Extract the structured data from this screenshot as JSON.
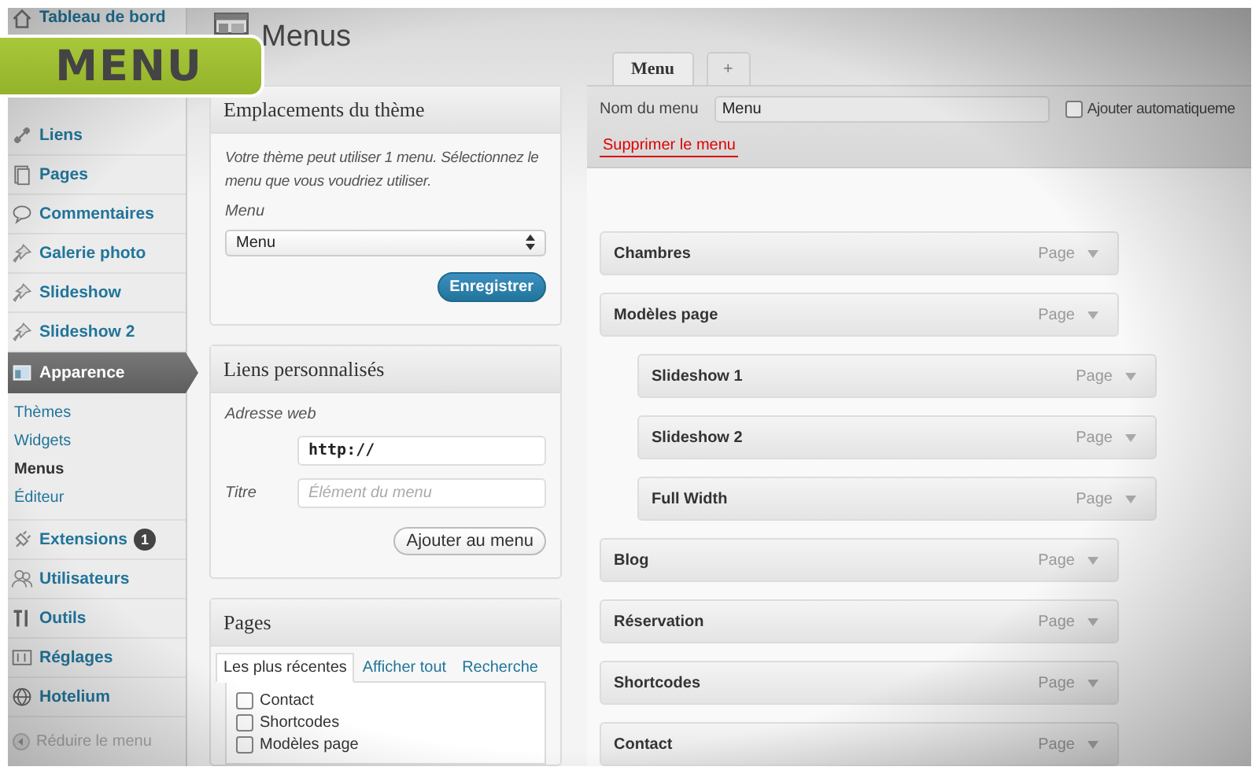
{
  "banner": {
    "label": "MENU"
  },
  "sidebar": {
    "items": [
      {
        "label": "Tableau de bord",
        "selected": false
      },
      {
        "label": "Liens",
        "selected": false
      },
      {
        "label": "Pages",
        "selected": false
      },
      {
        "label": "Commentaires",
        "selected": false
      },
      {
        "label": "Galerie photo",
        "selected": false
      },
      {
        "label": "Slideshow",
        "selected": false
      },
      {
        "label": "Slideshow 2",
        "selected": false
      },
      {
        "label": "Apparence",
        "selected": true,
        "children": [
          {
            "label": "Thèmes",
            "selected": false
          },
          {
            "label": "Widgets",
            "selected": false
          },
          {
            "label": "Menus",
            "selected": true
          },
          {
            "label": "Éditeur",
            "selected": false
          }
        ]
      },
      {
        "label": "Extensions",
        "selected": false,
        "badge": "1"
      },
      {
        "label": "Utilisateurs",
        "selected": false
      },
      {
        "label": "Outils",
        "selected": false
      },
      {
        "label": "Réglages",
        "selected": false
      },
      {
        "label": "Hotelium",
        "selected": false
      }
    ],
    "collapse": "Réduire le menu"
  },
  "page_title": "Menus",
  "theme_locations": {
    "title": "Emplacements du thème",
    "description": "Votre thème peut utiliser 1 menu. Sélectionnez le menu que vous voudriez utiliser.",
    "menu_label": "Menu",
    "menu_value": "Menu",
    "save_button": "Enregistrer"
  },
  "custom_links": {
    "title": "Liens personnalisés",
    "url_label": "Adresse web",
    "url_value": "http://",
    "title_label": "Titre",
    "title_placeholder": "Élément du menu",
    "add_button": "Ajouter au menu"
  },
  "pages": {
    "title": "Pages",
    "tabs": [
      {
        "label": "Les plus récentes",
        "selected": true
      },
      {
        "label": "Afficher tout",
        "selected": false
      },
      {
        "label": "Recherche",
        "selected": false
      }
    ],
    "items": [
      {
        "label": "Contact",
        "checked": false
      },
      {
        "label": "Shortcodes",
        "checked": false
      },
      {
        "label": "Modèles page",
        "checked": false
      }
    ]
  },
  "menu_tabs": [
    {
      "label": "Menu",
      "selected": true
    },
    {
      "label": "+",
      "selected": false
    }
  ],
  "menu_header": {
    "name_label": "Nom du menu",
    "name_value": "Menu",
    "auto_add": {
      "label": "Ajouter automatiqueme",
      "checked": false
    },
    "delete_link": "Supprimer le menu"
  },
  "menu_items": [
    {
      "title": "Chambres",
      "type": "Page"
    },
    {
      "title": "Modèles page",
      "type": "Page",
      "children": [
        {
          "title": "Slideshow 1",
          "type": "Page"
        },
        {
          "title": "Slideshow 2",
          "type": "Page"
        },
        {
          "title": "Full Width",
          "type": "Page"
        }
      ]
    },
    {
      "title": "Blog",
      "type": "Page"
    },
    {
      "title": "Réservation",
      "type": "Page"
    },
    {
      "title": "Shortcodes",
      "type": "Page"
    },
    {
      "title": "Contact",
      "type": "Page"
    }
  ]
}
